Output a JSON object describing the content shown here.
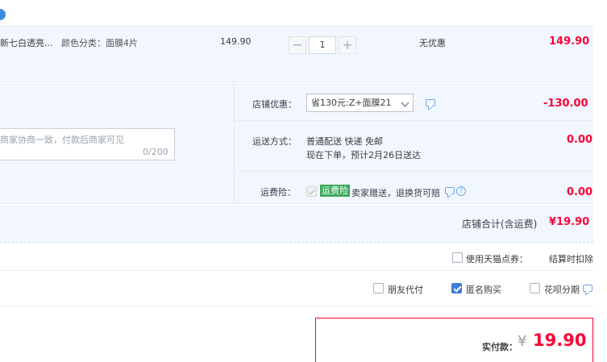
{
  "item": {
    "title": "新七白透亮...",
    "attr": "颜色分类：面膜4片",
    "price": "149.90",
    "qty_minus": "−",
    "qty": "1",
    "qty_plus": "+",
    "promo": "无优惠",
    "subtotal": "149.90"
  },
  "message": {
    "placeholder": "商家协商一致，付款后商家可见",
    "counter": "0/200"
  },
  "shop_discount": {
    "label": "店铺优惠：",
    "selected": "省130元:Z+面膜21",
    "amount": "-130.00"
  },
  "shipping": {
    "label": "运送方式：",
    "method": "普通配送 快递 免邮",
    "eta": "现在下单，预计2月26日送达",
    "amount": "0.00"
  },
  "insurance": {
    "label": "运费险：",
    "badge": "运费险",
    "desc": "卖家赠送，退换货可赔",
    "amount": "0.00"
  },
  "shop_total": {
    "label": "店铺合计(含运费)",
    "amount": "¥19.90"
  },
  "coupon": {
    "label": "使用天猫点券：",
    "note": "结算时扣除"
  },
  "options": {
    "friend_pay": "朋友代付",
    "anonymous": "匿名购买",
    "huabei": "花呗分期"
  },
  "payment": {
    "label": "实付款：",
    "currency": "¥",
    "amount": "19.90"
  },
  "colors": {
    "accent_red": "#ff0036",
    "light_blue_bg": "#f2f7ff",
    "badge_green": "#3aa95b"
  }
}
